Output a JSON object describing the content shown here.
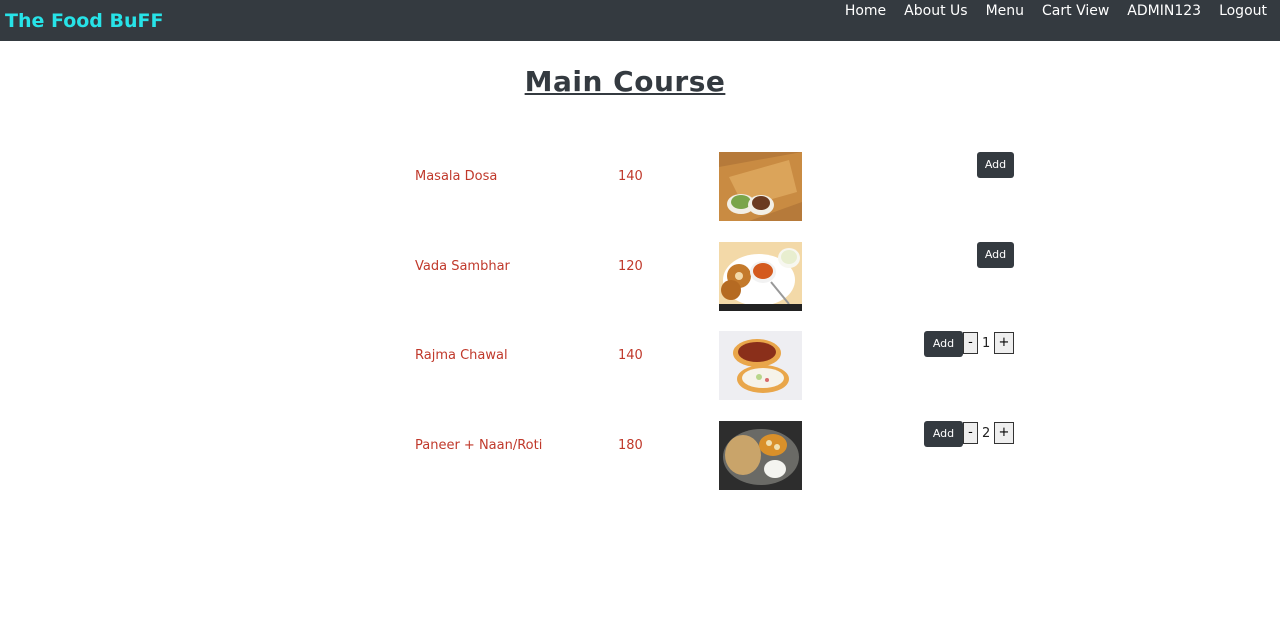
{
  "brand": "The Food BuFF",
  "nav": [
    "Home",
    "About Us",
    "Menu",
    "Cart View",
    "ADMIN123",
    "Logout"
  ],
  "page_title": "Main Course",
  "items": [
    {
      "name": "Masala Dosa",
      "price": "140",
      "add_label": "Add",
      "quantity": null,
      "image": "masala-dosa-image"
    },
    {
      "name": "Vada Sambhar",
      "price": "120",
      "add_label": "Add",
      "quantity": null,
      "image": "vada-sambhar-image"
    },
    {
      "name": "Rajma Chawal",
      "price": "140",
      "add_label": "Add",
      "quantity": "1",
      "minus_label": "-",
      "plus_label": "+",
      "image": "rajma-chawal-image"
    },
    {
      "name": "Paneer + Naan/Roti",
      "price": "180",
      "add_label": "Add",
      "quantity": "2",
      "minus_label": "-",
      "plus_label": "+",
      "image": "paneer-naan-image"
    }
  ],
  "colors": {
    "navbar": "#343a40",
    "brand": "#27e3e8",
    "item_text": "#c0392b",
    "button": "#343a40"
  }
}
